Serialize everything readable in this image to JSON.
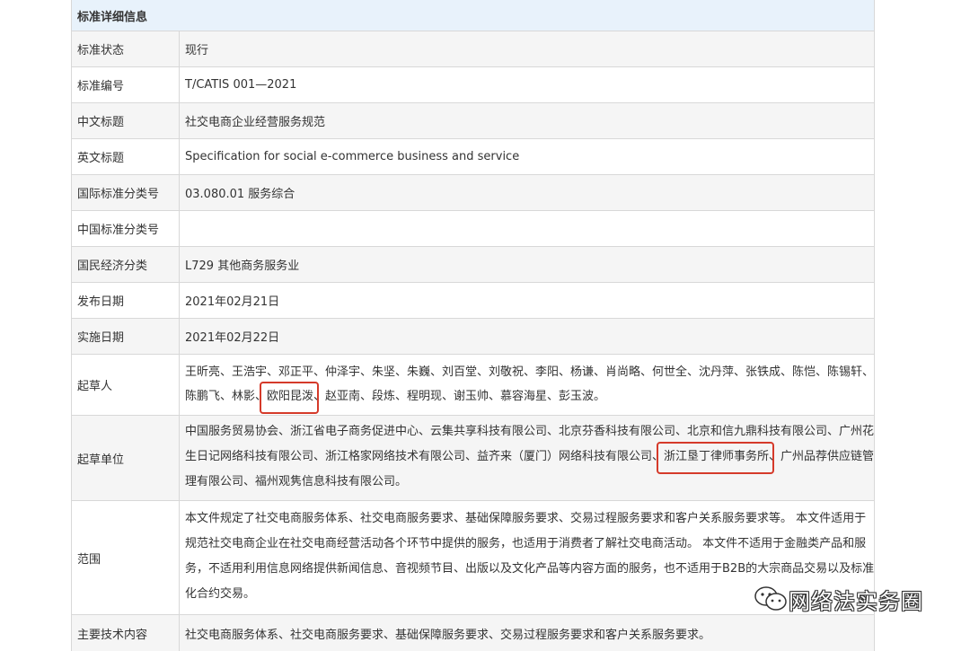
{
  "header": {
    "title": "标准详细信息"
  },
  "rows": [
    {
      "label": "标准状态",
      "value": "现行"
    },
    {
      "label": "标准编号",
      "value": "T/CATIS 001—2021"
    },
    {
      "label": "中文标题",
      "value": "社交电商企业经营服务规范"
    },
    {
      "label": "英文标题",
      "value": "Specification for social e-commerce business and service"
    },
    {
      "label": "国际标准分类号",
      "value": "03.080.01 服务综合"
    },
    {
      "label": "中国标准分类号",
      "value": ""
    },
    {
      "label": "国民经济分类",
      "value": "L729 其他商务服务业"
    },
    {
      "label": "发布日期",
      "value": "2021年02月21日"
    },
    {
      "label": "实施日期",
      "value": "2021年02月22日"
    }
  ],
  "drafters": {
    "label": "起草人",
    "line1": "王昕亮、王浩宇、邓正平、仲泽宇、朱坚、朱巍、刘百堂、刘敬祝、李阳、杨谦、肖尚略、何世全、沈丹萍、张铁成、陈恺、陈锡轩、",
    "line2_pre": "陈鹏飞、林影、",
    "line2_mark": "欧阳昆泼",
    "line2_post": "、赵亚南、段炼、程明现、谢玉帅、慕容海星、彭玉波。"
  },
  "units": {
    "label": "起草单位",
    "line1": "中国服务贸易协会、浙江省电子商务促进中心、云集共享科技有限公司、北京芬香科技有限公司、北京和信九鼎科技有限公司、广州花",
    "line2_pre": "生日记网络科技有限公司、浙江格家网络技术有限公司、益齐来（厦门）网络科技有限公司、",
    "line2_mark": "浙江垦丁律师事务所",
    "line2_post": "、广州品荐供应链管",
    "line3": "理有限公司、福州观隽信息科技有限公司。"
  },
  "scope": {
    "label": "范围",
    "lines": [
      "本文件规定了社交电商服务体系、社交电商服务要求、基础保障服务要求、交易过程服务要求和客户关系服务要求等。 本文件适用于",
      "规范社交电商企业在社交电商经营活动各个环节中提供的服务，也适用于消费者了解社交电商活动。 本文件不适用于金融类产品和服",
      "务，不适用利用信息网络提供新闻信息、音视频节目、出版以及文化产品等内容方面的服务，也不适用于B2B的大宗商品交易以及标准",
      "化合约交易。"
    ]
  },
  "tech": {
    "label": "主要技术内容",
    "value": "社交电商服务体系、社交电商服务要求、基础保障服务要求、交易过程服务要求和客户关系服务要求。"
  },
  "watermark": {
    "text": "网络法实务圈",
    "icon": "wechat-icon"
  },
  "colors": {
    "header_bg": "#e8f2fb",
    "highlight_border": "#d53a2a",
    "alt_row_bg": "#f5f5f5"
  }
}
